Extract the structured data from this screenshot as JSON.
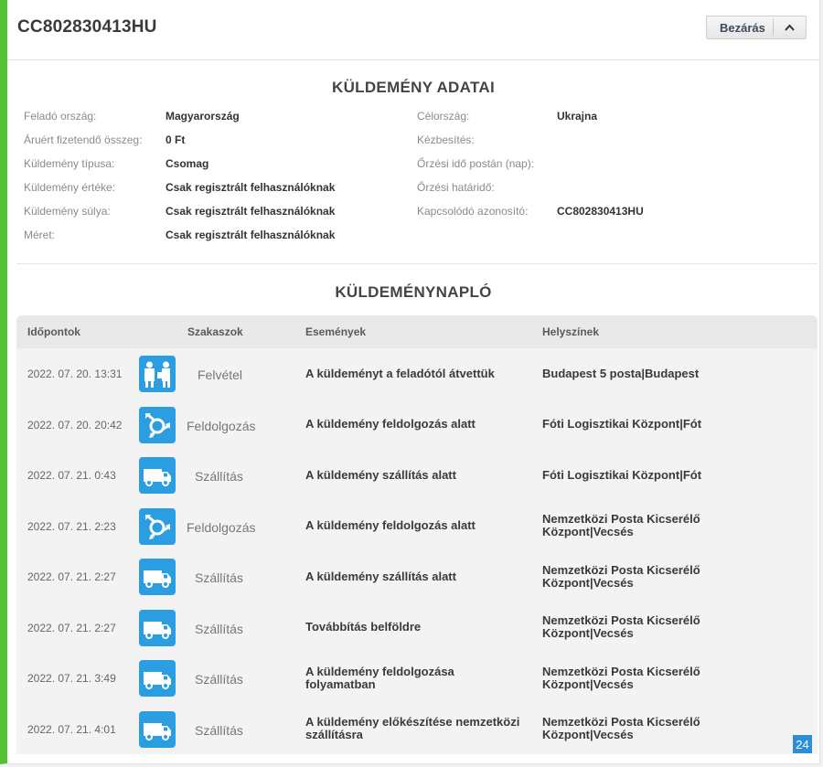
{
  "header": {
    "tracking_number": "CC802830413HU",
    "close_label": "Bezárás"
  },
  "details": {
    "title": "KÜLDEMÉNY ADATAI",
    "left": [
      {
        "label": "Feladó ország:",
        "value": "Magyarország"
      },
      {
        "label": "Áruért fizetendő összeg:",
        "value": "0 Ft"
      },
      {
        "label": "Küldemény típusa:",
        "value": "Csomag"
      },
      {
        "label": "Küldemény értéke:",
        "value": "Csak regisztrált felhasználóknak"
      },
      {
        "label": "Küldemény súlya:",
        "value": "Csak regisztrált felhasználóknak"
      },
      {
        "label": "Méret:",
        "value": "Csak regisztrált felhasználóknak"
      }
    ],
    "right": [
      {
        "label": "Célország:",
        "value": "Ukrajna"
      },
      {
        "label": "Kézbesítés:",
        "value": ""
      },
      {
        "label": "Őrzési idő postán (nap):",
        "value": ""
      },
      {
        "label": "Őrzési határidő:",
        "value": ""
      },
      {
        "label": "Kapcsolódó azonosító:",
        "value": "CC802830413HU"
      }
    ]
  },
  "log": {
    "title": "KÜLDEMÉNYNAPLÓ",
    "columns": {
      "time": "Időpontok",
      "stage": "Szakaszok",
      "event": "Események",
      "place": "Helyszínek"
    },
    "rows": [
      {
        "time": "2022. 07. 20. 13:31",
        "icon": "pickup-icon",
        "stage": "Felvétel",
        "event": "A küldeményt a feladótól átvettük",
        "place": "Budapest 5 posta|Budapest"
      },
      {
        "time": "2022. 07. 20. 20:42",
        "icon": "processing-icon",
        "stage": "Feldolgozás",
        "event": "A küldemény feldolgozás alatt",
        "place": "Fóti Logisztikai Központ|Fót"
      },
      {
        "time": "2022. 07. 21. 0:43",
        "icon": "van-icon",
        "stage": "Szállítás",
        "event": "A küldemény szállítás alatt",
        "place": "Fóti Logisztikai Központ|Fót"
      },
      {
        "time": "2022. 07. 21. 2:23",
        "icon": "processing-icon",
        "stage": "Feldolgozás",
        "event": "A küldemény feldolgozás alatt",
        "place": "Nemzetközi Posta Kicserélő Központ|Vecsés"
      },
      {
        "time": "2022. 07. 21. 2:27",
        "icon": "van-icon",
        "stage": "Szállítás",
        "event": "A küldemény szállítás alatt",
        "place": "Nemzetközi Posta Kicserélő Központ|Vecsés"
      },
      {
        "time": "2022. 07. 21. 2:27",
        "icon": "van-icon",
        "stage": "Szállítás",
        "event": "Továbbítás belföldre",
        "place": "Nemzetközi Posta Kicserélő Központ|Vecsés"
      },
      {
        "time": "2022. 07. 21. 3:49",
        "icon": "van-icon",
        "stage": "Szállítás",
        "event": "A küldemény feldolgozása folyamatban",
        "place": "Nemzetközi Posta Kicserélő Központ|Vecsés"
      },
      {
        "time": "2022. 07. 21. 4:01",
        "icon": "van-icon",
        "stage": "Szállítás",
        "event": "A küldemény előkészítése nemzetközi szállításra",
        "place": "Nemzetközi Posta Kicserélő Központ|Vecsés"
      }
    ]
  },
  "corner_badge": "24",
  "colors": {
    "accent_green": "#56c039",
    "icon_blue": "#2a9ee0",
    "badge_blue": "#2a8fd8"
  }
}
